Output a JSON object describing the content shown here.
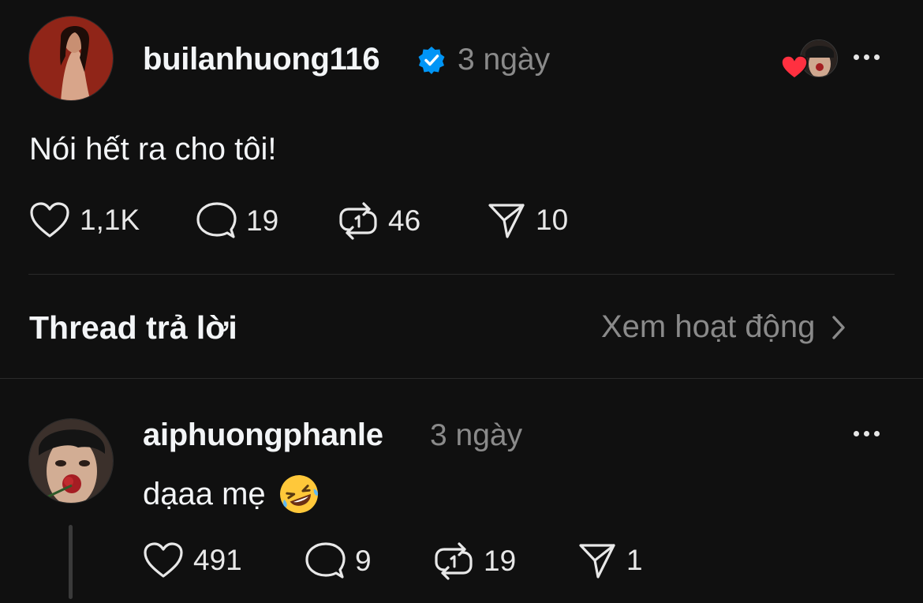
{
  "post": {
    "username": "builanhuong116",
    "verified": true,
    "time": "3 ngày",
    "text": "Nói hết ra cho tôi!",
    "stats": {
      "likes": "1,1K",
      "replies": "19",
      "reposts": "46",
      "shares": "10"
    }
  },
  "replies_section": {
    "title": "Thread trả lời",
    "view_activity": "Xem hoạt động"
  },
  "reply": {
    "username": "aiphuongphanle",
    "time": "3 ngày",
    "text": "dạaa mẹ",
    "emoji": "🤣",
    "stats": {
      "likes": "491",
      "replies": "9",
      "reposts": "19",
      "shares": "1"
    }
  },
  "colors": {
    "background": "#101010",
    "verified_badge": "#0095f6",
    "like_heart": "#ff3040",
    "muted_text": "#8a8a8a"
  },
  "icons": [
    "heart-icon",
    "comment-icon",
    "repost-icon",
    "share-icon",
    "verified-badge-icon",
    "more-icon",
    "chevron-right-icon"
  ]
}
